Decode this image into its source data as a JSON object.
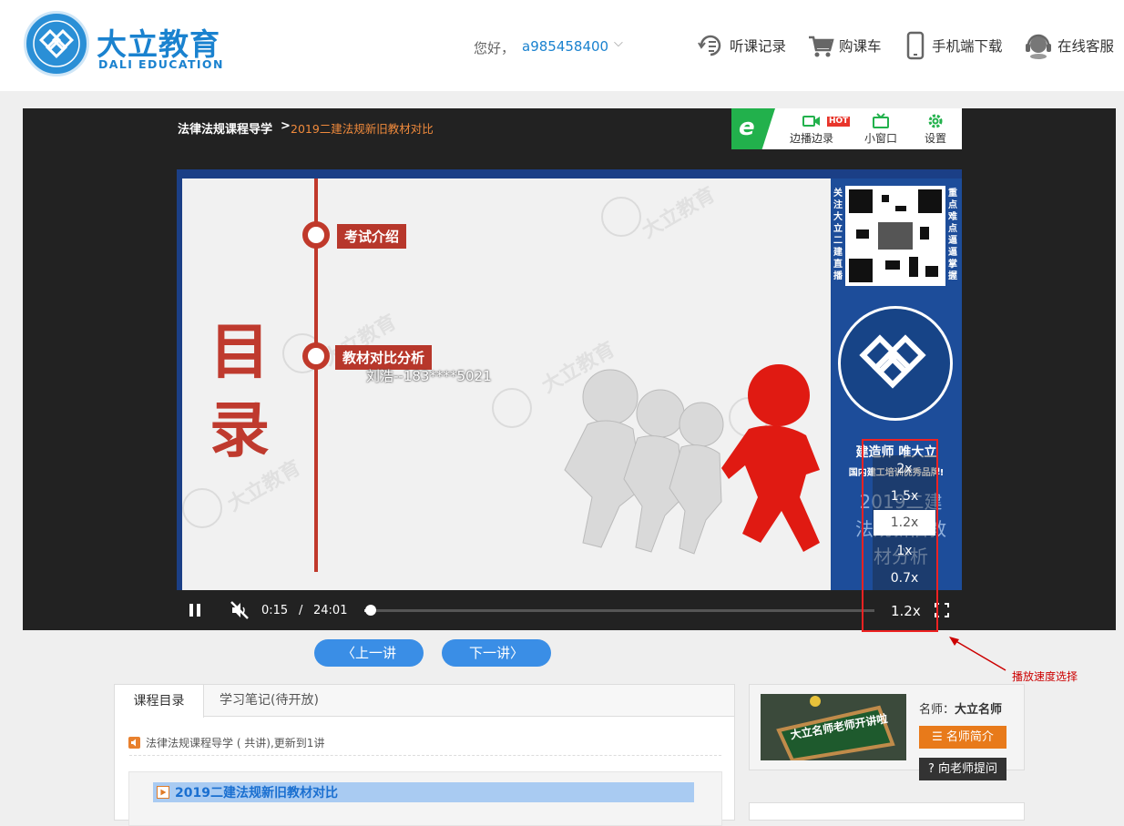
{
  "header": {
    "brand_cn": "大立教育",
    "brand_en": "DALI EDUCATION",
    "greeting": "您好，",
    "username": "a985458400",
    "nav": [
      {
        "label": "听课记录",
        "icon": "history-icon"
      },
      {
        "label": "购课车",
        "icon": "cart-icon"
      },
      {
        "label": "手机端下载",
        "icon": "mobile-icon"
      },
      {
        "label": "在线客服",
        "icon": "headset-icon"
      }
    ]
  },
  "player": {
    "breadcrumb_parent": "法律法规课程导学",
    "breadcrumb_sep": ">",
    "breadcrumb_current": "2019二建法规新旧教材对比",
    "tools": [
      {
        "label": "边播边录",
        "icon": "record-icon",
        "badge": "HOT"
      },
      {
        "label": "小窗口",
        "icon": "tv-icon"
      },
      {
        "label": "设置",
        "icon": "gear-icon"
      }
    ],
    "slide": {
      "toc_title": "目录",
      "items": [
        "考试介绍",
        "教材对比分析"
      ],
      "watermark_user": "刘浩--183****5021",
      "watermark_brand": "大立教育",
      "side_follow": "关注大立二建直播",
      "side_focus": "重点难点逼逼掌握",
      "side_slogan": "建造师 唯大立",
      "side_slogan2": "国内建工培训优秀品牌!",
      "side_title": "2019二建法规新旧教材分析"
    },
    "time_current": "0:15",
    "time_sep": "/",
    "time_total": "24:01",
    "progress": 0.01,
    "speed_current": "1.2x",
    "speed_options": [
      "2x",
      "1.5x",
      "1.2x",
      "1x",
      "0.7x"
    ],
    "speed_selected": "1.2x",
    "annotation": "播放速度选择"
  },
  "nav_buttons": {
    "prev": "上一讲",
    "next": "下一讲"
  },
  "course": {
    "tabs": [
      "课程目录",
      "学习笔记(待开放)"
    ],
    "summary": "法律法规课程导学 ( 共讲),更新到1讲",
    "lesson_title": "2019二建法规新旧教材对比"
  },
  "teacher": {
    "label_prefix": "名师：",
    "name": "大立名师",
    "intro_button": "名师简介",
    "ask_button": "向老师提问",
    "img_text": "大立名师老师开讲啦"
  },
  "colors": {
    "brand_blue": "#1a82cf",
    "accent_orange": "#e87a1a",
    "slide_red": "#c0392b",
    "annotation_red": "#e22"
  }
}
